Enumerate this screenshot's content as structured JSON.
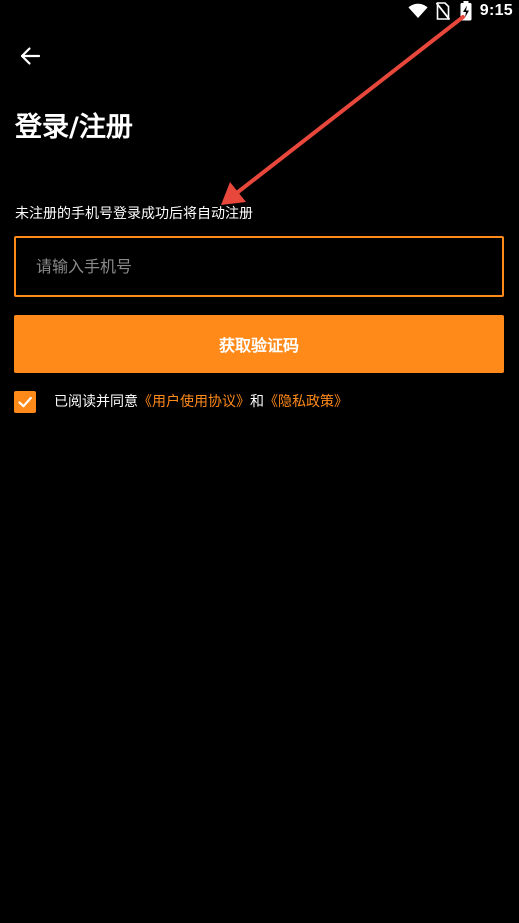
{
  "status_bar": {
    "time": "9:15",
    "icons": [
      "wifi-icon",
      "no-sim-icon",
      "battery-charging-icon"
    ]
  },
  "header": {
    "back_icon": "arrow-left-icon"
  },
  "page": {
    "title": "登录/注册",
    "hint": "未注册的手机号登录成功后将自动注册"
  },
  "phone_input": {
    "placeholder": "请输入手机号",
    "value": ""
  },
  "get_code_button": {
    "label": "获取验证码"
  },
  "agreement": {
    "checked": true,
    "prefix": "已阅读并同意",
    "user_agreement": "《用户使用协议》",
    "and": "和",
    "privacy_policy": "《隐私政策》"
  },
  "colors": {
    "accent": "#ff8a1a",
    "background": "#000000",
    "text": "#ffffff",
    "placeholder": "#8a8a8a",
    "annotation": "#e8473c"
  }
}
